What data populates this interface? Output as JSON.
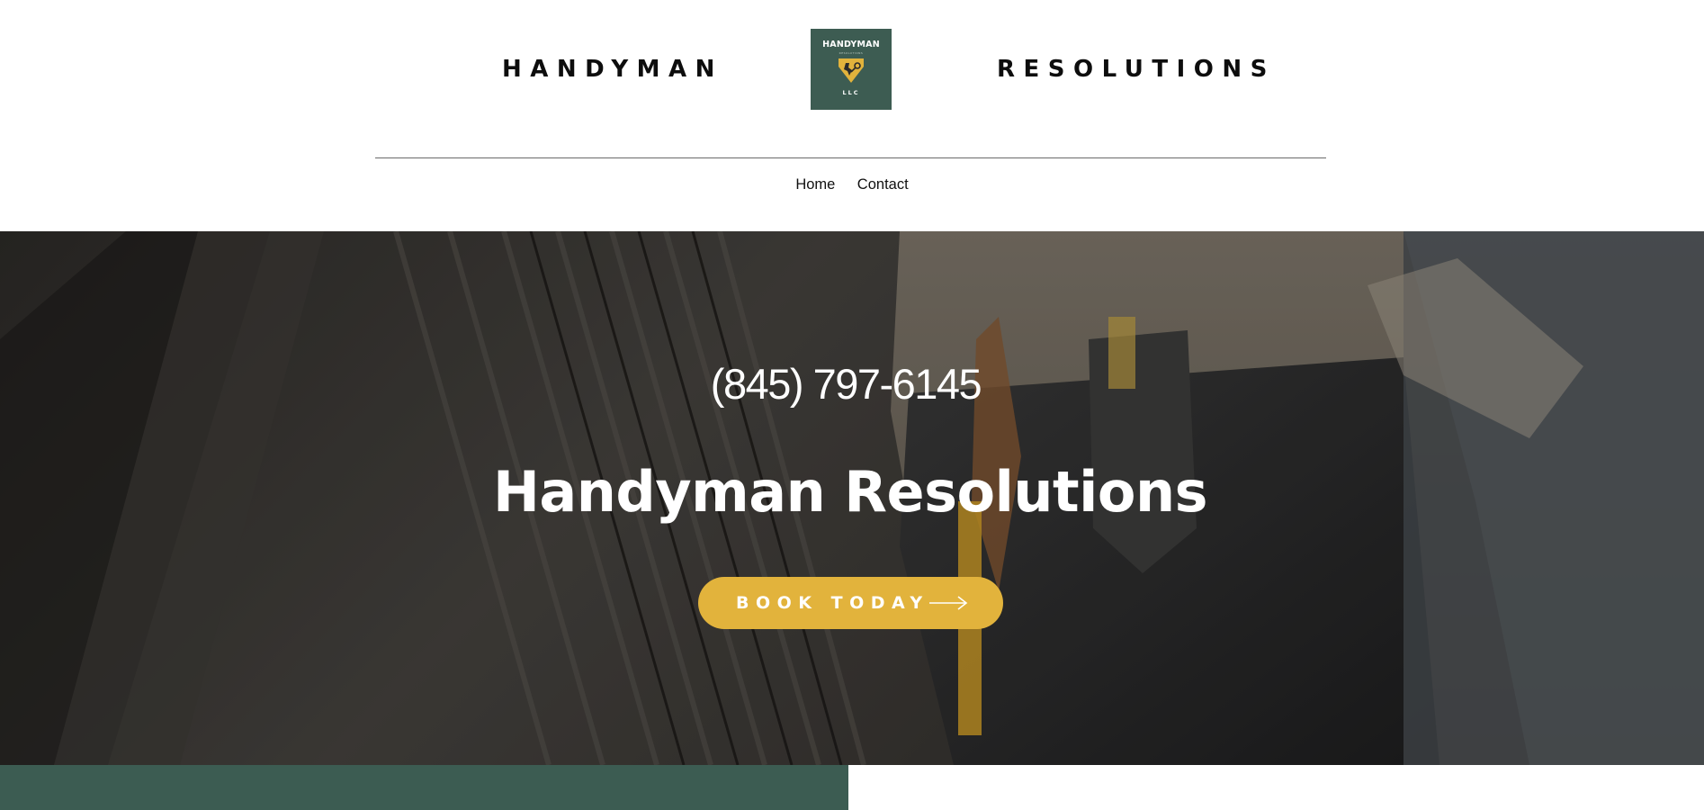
{
  "header": {
    "brand_left": "HANDYMAN",
    "brand_right": "RESOLUTIONS",
    "logo": {
      "top_text": "HANDYMAN",
      "sub_text": "RESOLUTIONS",
      "bottom_text": "LLC",
      "background_color": "#3d5c52",
      "emblem_color": "#e2b33c"
    }
  },
  "nav": {
    "items": [
      {
        "label": "Home"
      },
      {
        "label": "Contact"
      }
    ]
  },
  "hero": {
    "phone": "(845) 797-6145",
    "title": "Handyman Resolutions",
    "cta": {
      "label": "BOOK TODAY",
      "icon": "arrow-right-icon",
      "color": "#e2b33c"
    }
  },
  "colors": {
    "accent": "#e2b33c",
    "brand_green": "#3c5c52",
    "text_dark": "#0d0d0d"
  }
}
